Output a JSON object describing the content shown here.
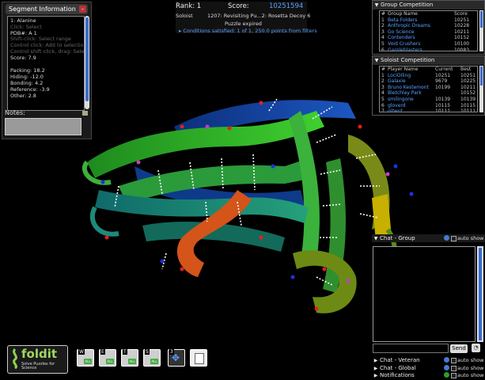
{
  "segment_info": {
    "title": "Segment Information",
    "lines": [
      "1: Alanine",
      "PDB#: A 1",
      "Score: 7.9",
      "Packing: 18.2",
      "Hiding: -12.0",
      "Bonding: 4.2",
      "Reference: -3.9",
      "Other: 2.8"
    ],
    "hint_lines": [
      "Click: Select",
      "Shift-click: Select range",
      "Control click: Add to selection",
      "Control shift click, drag: Select"
    ],
    "notes_label": "Notes:"
  },
  "top": {
    "rank_label": "Rank: 1",
    "score_label": "Score:",
    "score_value": "10251594",
    "mode": "Soloist",
    "puzzle_name": "1207: Revisiting Pu...2: Rosetta Decoy 6",
    "status": "Puzzle expired",
    "conditions": "Conditions satisfied: 1 of 1, 250.0 points from filters"
  },
  "group_competition": {
    "title": "Group Competition",
    "headers": [
      "#",
      "Group Name",
      "Score"
    ],
    "rows": [
      [
        "1",
        "Beta Folders",
        "10251"
      ],
      [
        "2",
        "Anthropic Dreams",
        "10228"
      ],
      [
        "3",
        "Go Science",
        "10211"
      ],
      [
        "4",
        "Contenders",
        "10152"
      ],
      [
        "5",
        "Void Crushers",
        "10100"
      ],
      [
        "6",
        "Gargleblasters",
        "10083"
      ],
      [
        "7",
        "L'Alliance Francopho...",
        "10063"
      ]
    ]
  },
  "soloist_competition": {
    "title": "Soloist Competition",
    "headers": [
      "#",
      "Player Name",
      "Current",
      "Best"
    ],
    "rows": [
      [
        "1",
        "LociOiling",
        "10251",
        "10251"
      ],
      [
        "2",
        "Galaxie",
        "9679",
        "10225"
      ],
      [
        "3",
        "Bruno Kestemont",
        "10199",
        "10211"
      ],
      [
        "4",
        "Bletchley Park",
        "",
        "10152"
      ],
      [
        "5",
        "smilingone",
        "10139",
        "10139"
      ],
      [
        "6",
        "gloverd",
        "10115",
        "10115"
      ],
      [
        "7",
        "gitwut",
        "10111",
        "10111"
      ]
    ]
  },
  "chat": {
    "group_title": "Chat - Group",
    "veteran_title": "Chat - Veteran",
    "global_title": "Chat - Global",
    "notifications_title": "Notifications",
    "auto_show": "auto show",
    "send_label": "Send"
  },
  "toolbar": {
    "logo_title": "foldit",
    "logo_sub": "Solve Puzzles for Science",
    "tools": [
      {
        "key": "W",
        "label": "Wiggle",
        "icon": "wiggle-icon"
      },
      {
        "key": "E",
        "label": "Shake",
        "icon": "shake-icon"
      },
      {
        "key": "T",
        "label": "Rebuild",
        "icon": "rebuild-icon"
      },
      {
        "key": "S",
        "label": "Sidechains",
        "icon": "sidechain-icon"
      },
      {
        "key": "3",
        "label": "Move",
        "icon": "move-icon"
      },
      {
        "key": "",
        "label": "Notes",
        "icon": "notepad-icon"
      }
    ]
  },
  "colors": {
    "score_blue": "#5aa0ff",
    "link_blue": "#5aa0ff",
    "accent_scroll": "#3a6cd0"
  }
}
